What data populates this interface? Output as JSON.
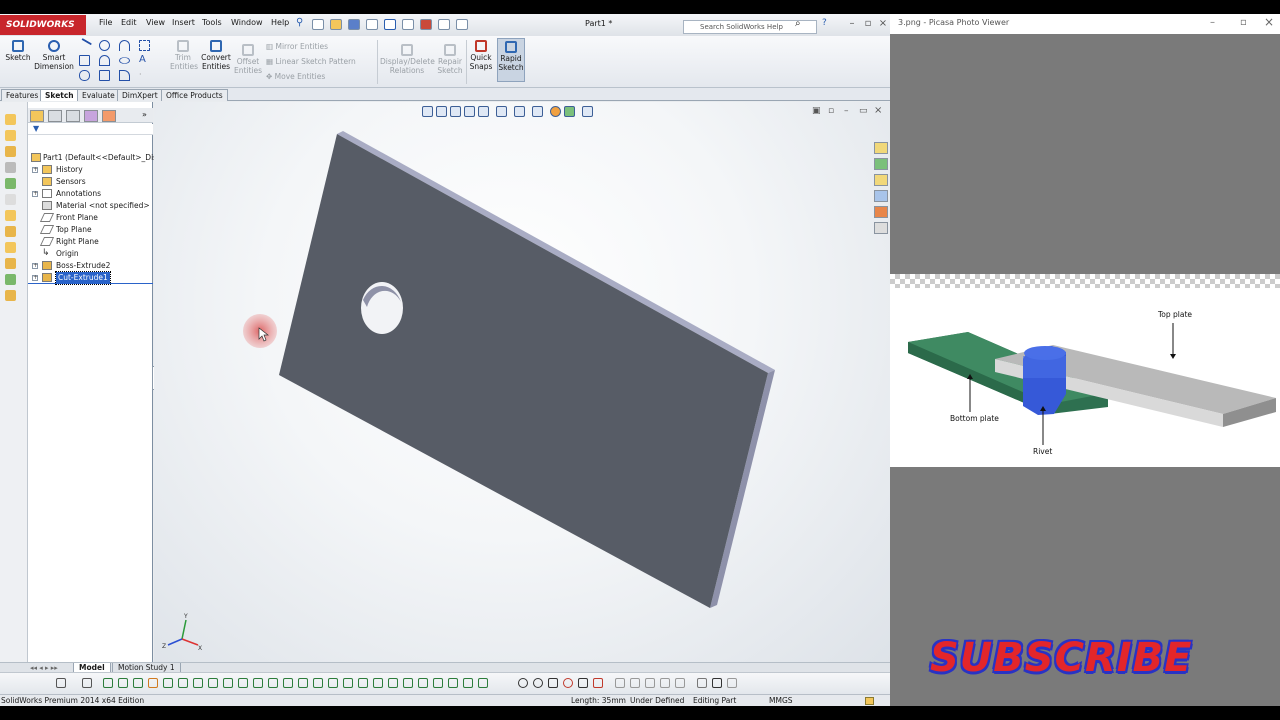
{
  "solidworks": {
    "logo": "SOLIDWORKS",
    "menus": [
      "File",
      "Edit",
      "View",
      "Insert",
      "Tools",
      "Window",
      "Help"
    ],
    "doc_title": "Part1 *",
    "search_placeholder": "Search SolidWorks Help",
    "ribbon": {
      "sketch": "Sketch",
      "smart_dimension_1": "Smart",
      "smart_dimension_2": "Dimension",
      "trim_1": "Trim",
      "trim_2": "Entities",
      "convert_1": "Convert",
      "convert_2": "Entities",
      "offset_1": "Offset",
      "offset_2": "Entities",
      "mirror": "Mirror Entities",
      "linear_pattern": "Linear Sketch Pattern",
      "move": "Move Entities",
      "display_delete_1": "Display/Delete",
      "display_delete_2": "Relations",
      "repair_1": "Repair",
      "repair_2": "Sketch",
      "quick_snaps_1": "Quick",
      "quick_snaps_2": "Snaps",
      "rapid_sketch_1": "Rapid",
      "rapid_sketch_2": "Sketch"
    },
    "tabs": [
      "Features",
      "Sketch",
      "Evaluate",
      "DimXpert",
      "Office Products"
    ],
    "active_tab": "Sketch",
    "tree": [
      {
        "label": "Part1  (Default<<Default>_Disp",
        "level": 0
      },
      {
        "label": "History",
        "level": 1
      },
      {
        "label": "Sensors",
        "level": 1
      },
      {
        "label": "Annotations",
        "level": 1
      },
      {
        "label": "Material <not specified>",
        "level": 1
      },
      {
        "label": "Front Plane",
        "level": 1
      },
      {
        "label": "Top Plane",
        "level": 1
      },
      {
        "label": "Right Plane",
        "level": 1
      },
      {
        "label": "Origin",
        "level": 1
      },
      {
        "label": "Boss-Extrude2",
        "level": 1
      },
      {
        "label": "Cut-Extrude1",
        "level": 1,
        "selected": true
      }
    ],
    "bottom_tabs": [
      "Model",
      "Motion Study 1"
    ],
    "status": {
      "edition": "SolidWorks Premium 2014 x64 Edition",
      "length": "Length: 35mm",
      "defined": "Under Defined",
      "mode": "Editing Part",
      "units": "MMGS"
    }
  },
  "picasa": {
    "title": "3.png - Picasa Photo Viewer",
    "labels": {
      "top_plate": "Top plate",
      "bottom_plate": "Bottom plate",
      "rivet": "Rivet"
    }
  },
  "overlay": {
    "subscribe": "SUBSCRIBE"
  },
  "colors": {
    "part_face": "#575c66",
    "bottom_plate": "#3f8a62",
    "rivet": "#4a6fe8",
    "top_plate": "#b9b9b9",
    "subscribe_fill": "#e3262a",
    "subscribe_outline": "#2933c4"
  }
}
